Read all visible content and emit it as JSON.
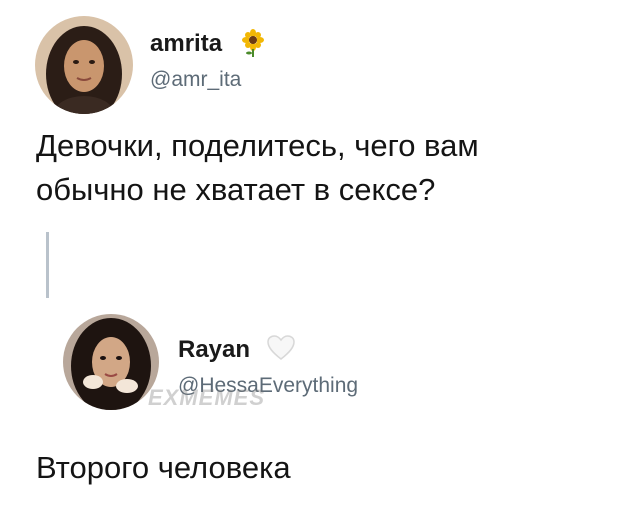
{
  "tweet1": {
    "name": "amrita",
    "name_emoji": "sunflower-icon",
    "handle": "@amr_ita",
    "text_line1": "Девочки, поделитесь, чего вам",
    "text_line2": "обычно не хватает в сексе?"
  },
  "tweet2": {
    "name": "Rayan",
    "name_emoji": "white-heart-icon",
    "handle": "@HessaEverything",
    "text": "Второго человека"
  },
  "watermark": "EXMEMES",
  "colors": {
    "background": "#ffffff",
    "text": "#141414",
    "handle": "#5d6b77",
    "thread_line": "#b9c2cb"
  }
}
